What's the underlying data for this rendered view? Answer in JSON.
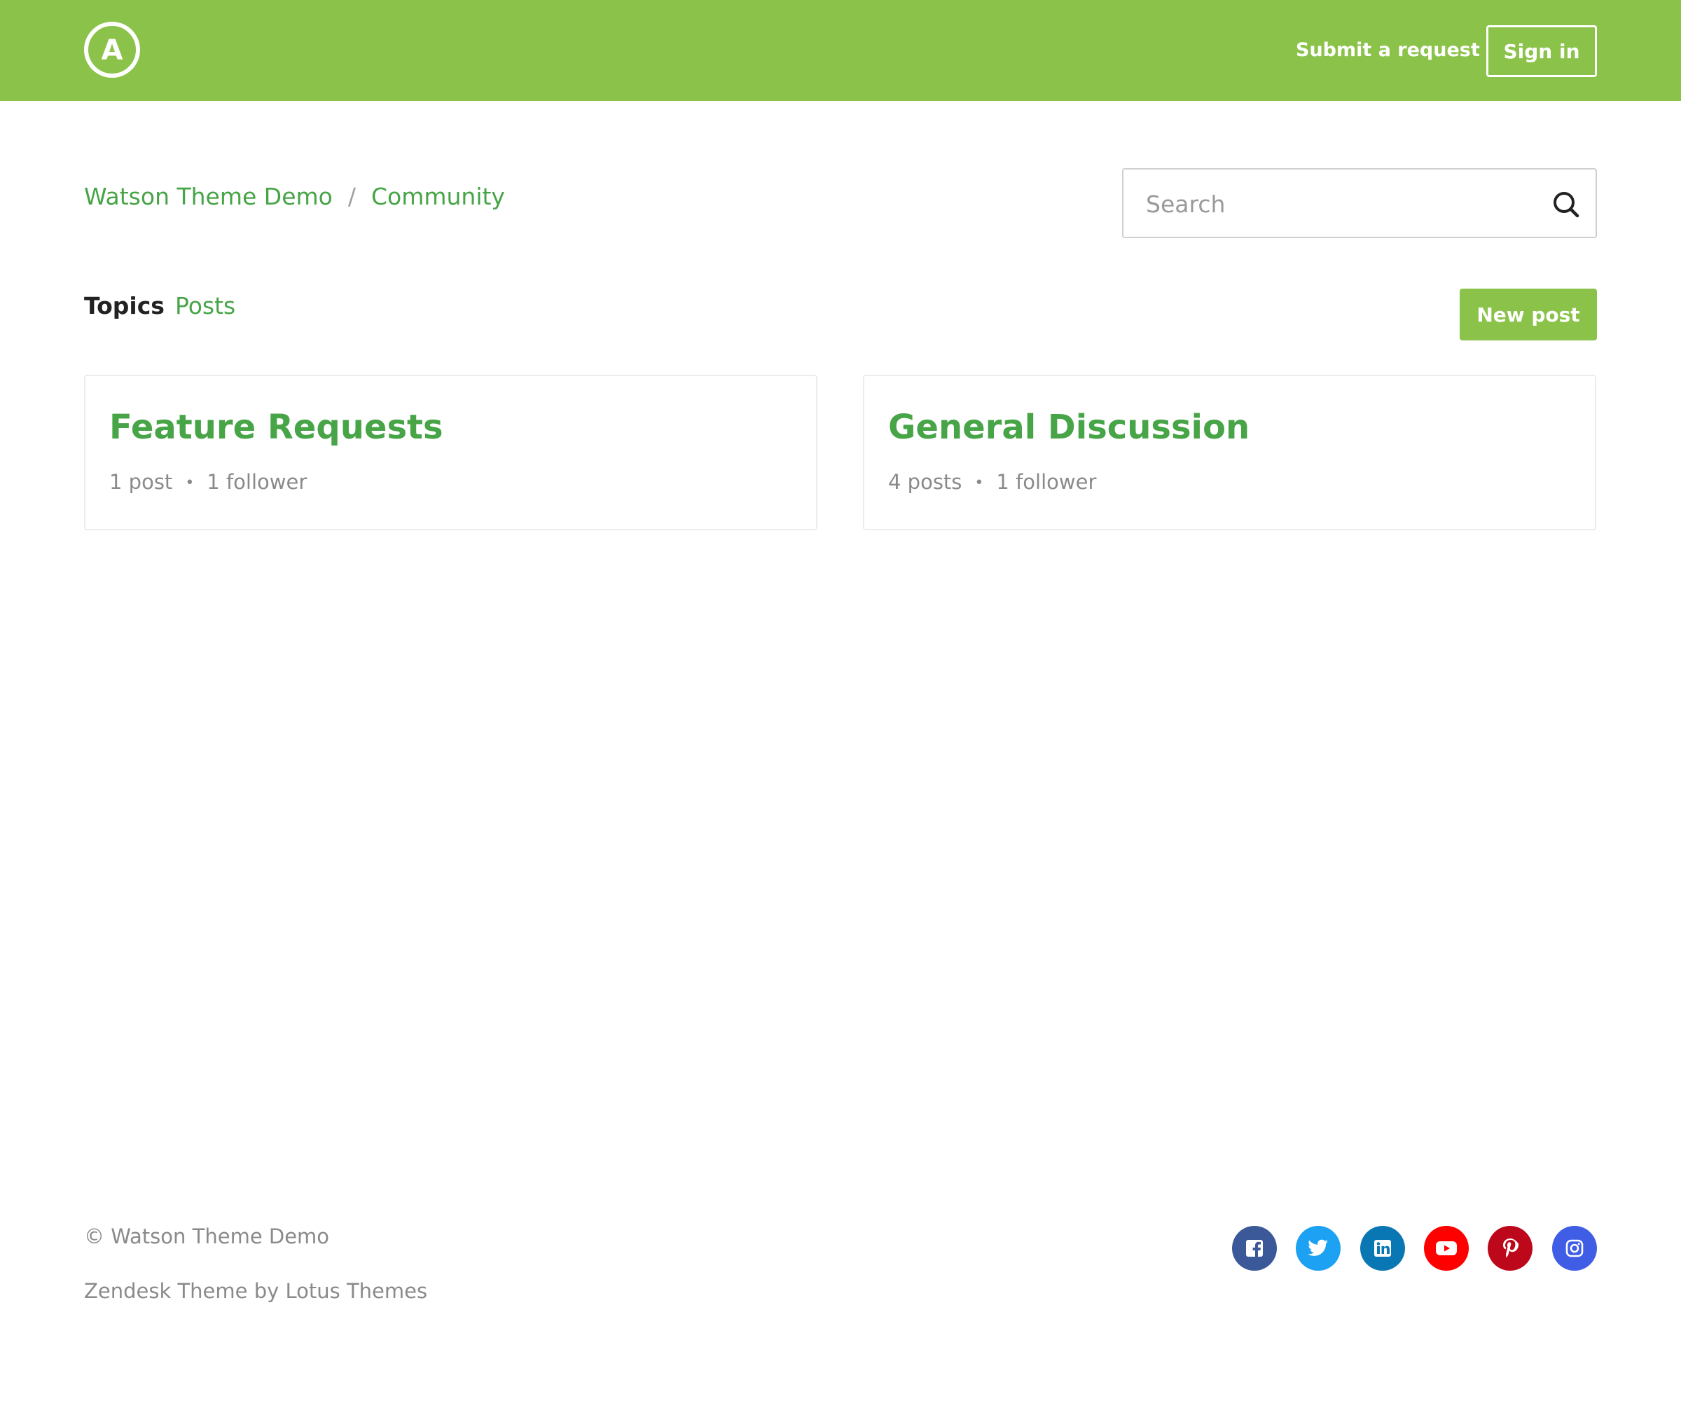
{
  "header": {
    "logo_letter": "A",
    "submit_request": "Submit a request",
    "sign_in": "Sign in"
  },
  "breadcrumb": {
    "items": [
      "Watson Theme Demo",
      "Community"
    ],
    "separator": "/"
  },
  "search": {
    "placeholder": "Search"
  },
  "tabs": {
    "topics": "Topics",
    "posts": "Posts"
  },
  "new_post": "New post",
  "topics": [
    {
      "title": "Feature Requests",
      "posts": "1 post",
      "followers": "1 follower"
    },
    {
      "title": "General Discussion",
      "posts": "4 posts",
      "followers": "1 follower"
    }
  ],
  "meta_separator": "•",
  "footer": {
    "copyright": "© Watson Theme Demo",
    "credit": "Zendesk Theme by Lotus Themes"
  },
  "social": [
    {
      "name": "facebook-icon",
      "color": "#3b5998"
    },
    {
      "name": "twitter-icon",
      "color": "#1da1f2"
    },
    {
      "name": "linkedin-icon",
      "color": "#0a77b5"
    },
    {
      "name": "youtube-icon",
      "color": "#ff0000"
    },
    {
      "name": "pinterest-icon",
      "color": "#bd081c"
    },
    {
      "name": "instagram-icon",
      "color": "#405de6"
    }
  ],
  "colors": {
    "brand": "#8bc34a",
    "link": "#47a447",
    "muted": "#8a8a8a"
  }
}
